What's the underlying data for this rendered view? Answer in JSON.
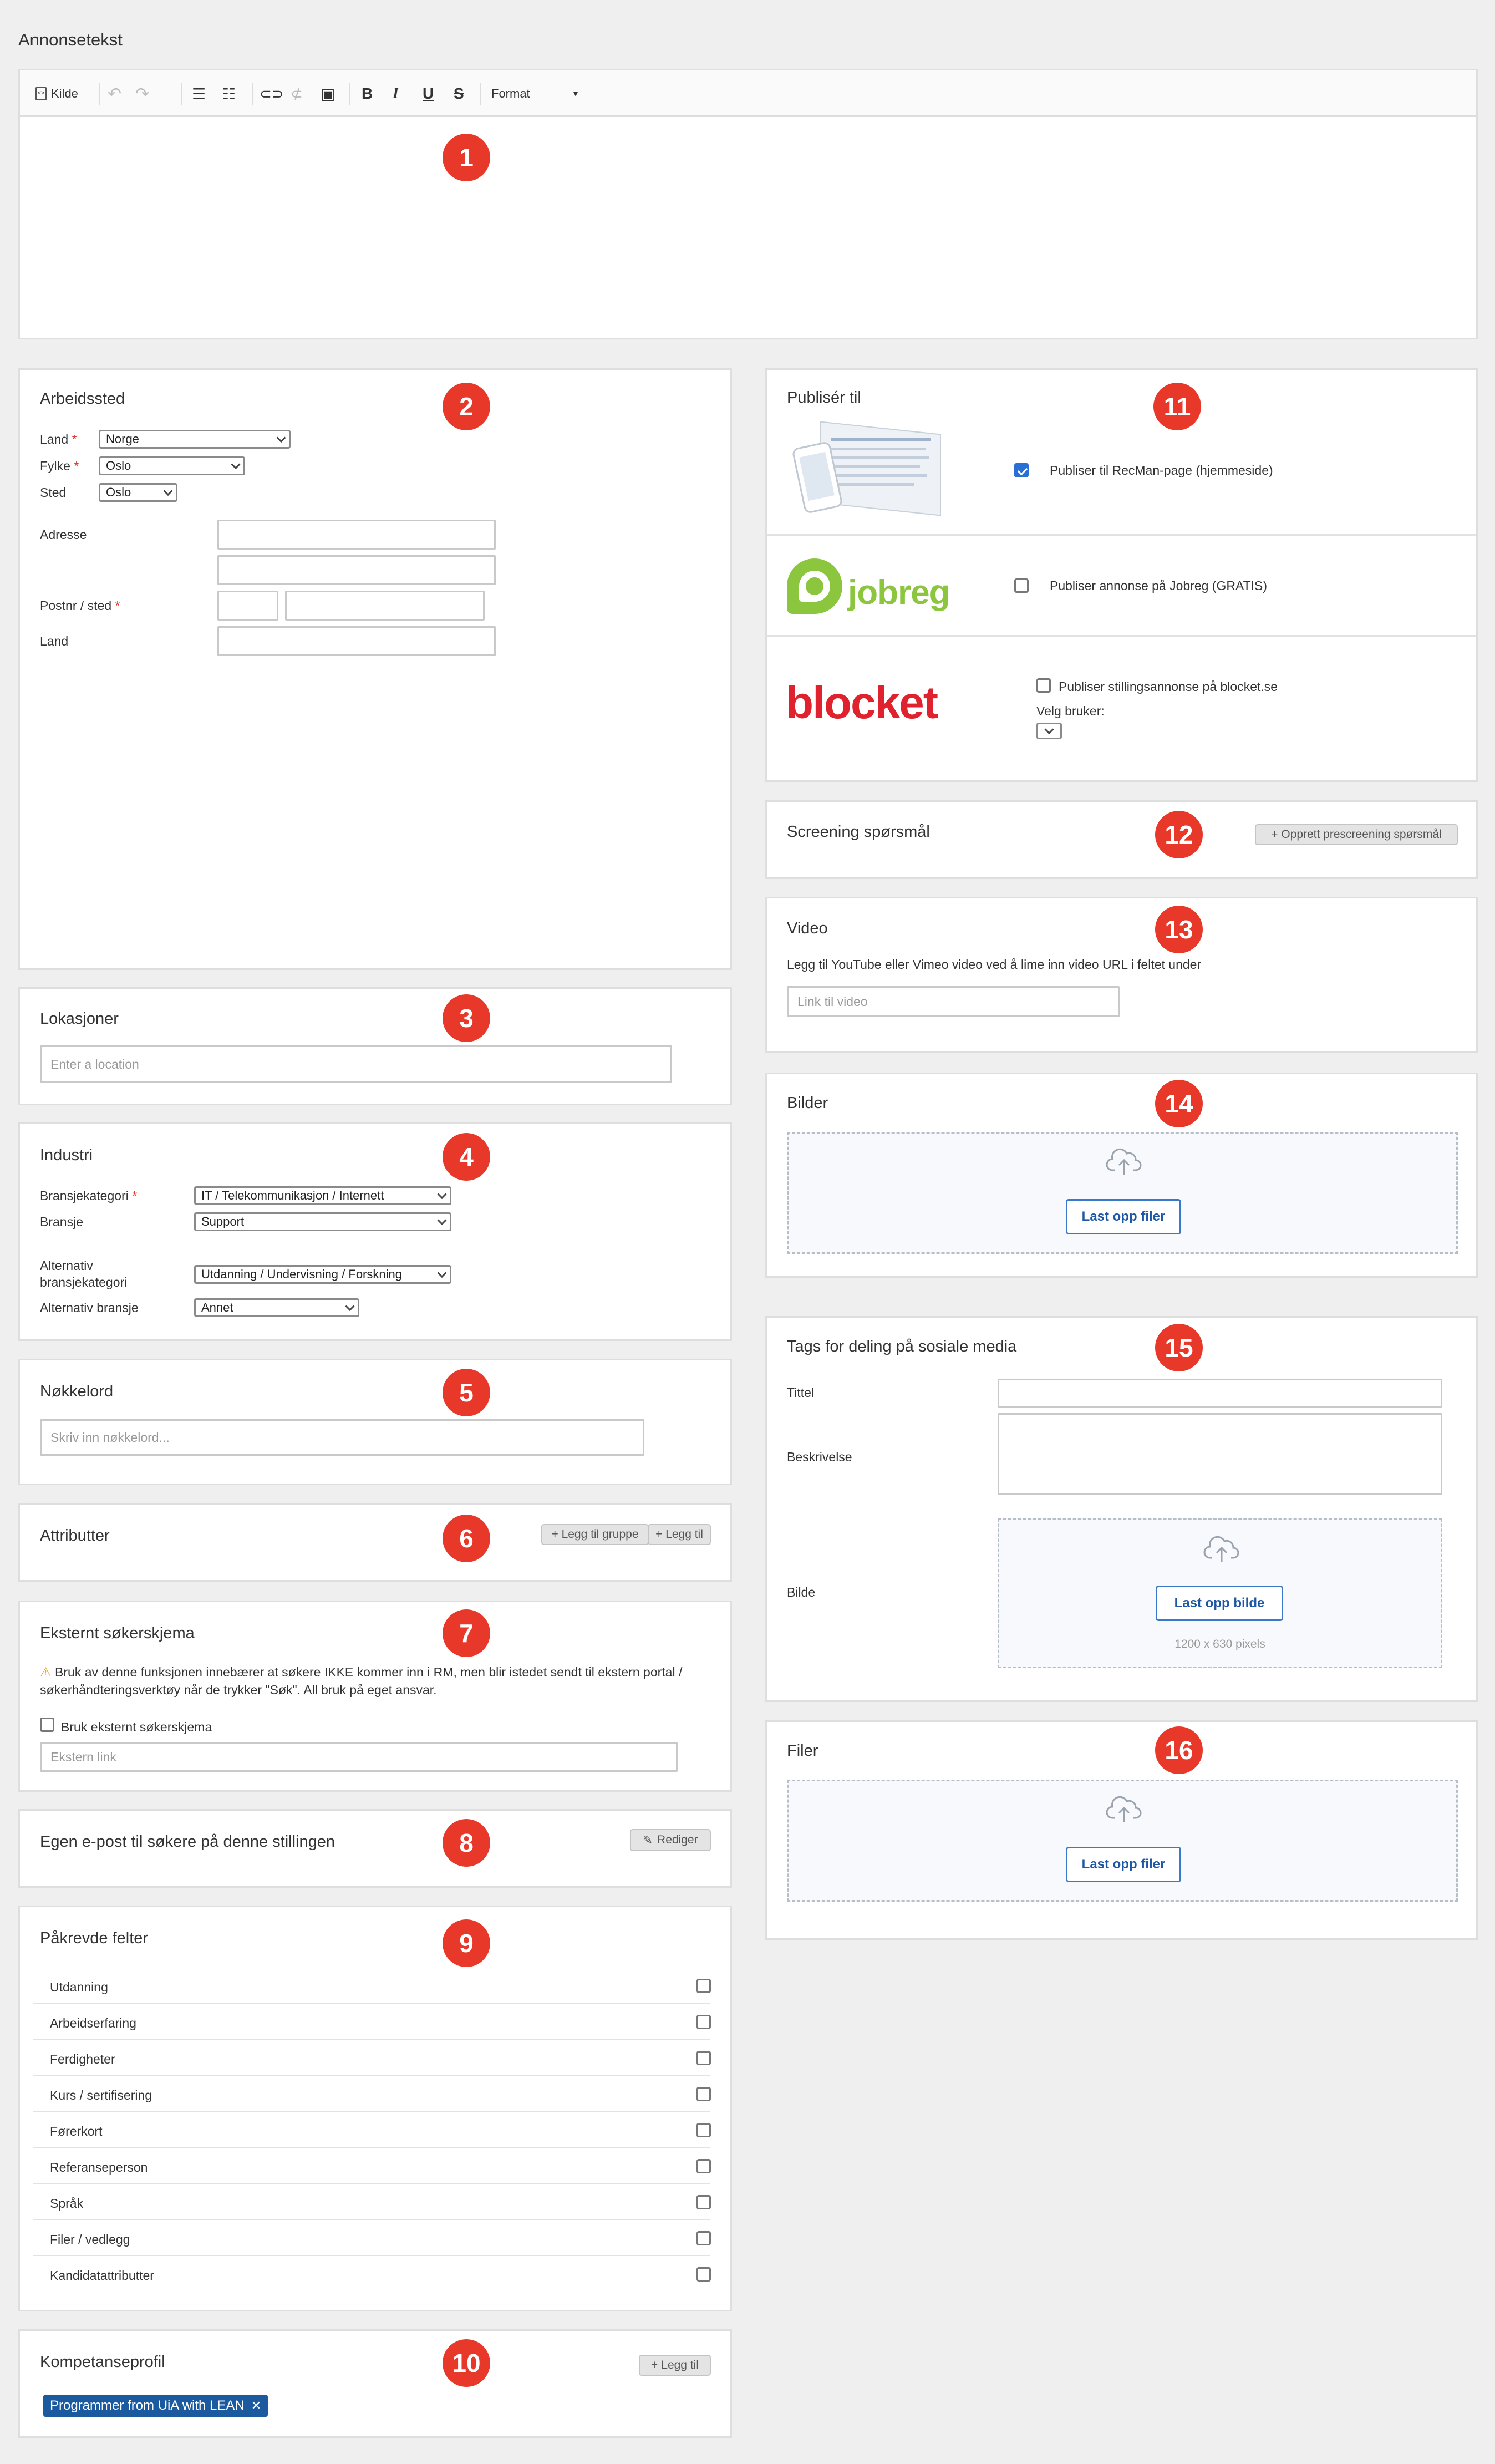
{
  "annonsetekst": {
    "title": "Annonsetekst",
    "toolbar": {
      "source_label": "Kilde",
      "format_label": "Format"
    }
  },
  "badges": [
    "1",
    "2",
    "3",
    "4",
    "5",
    "6",
    "7",
    "8",
    "9",
    "10",
    "11",
    "12",
    "13",
    "14",
    "15",
    "16"
  ],
  "arbeidssted": {
    "title": "Arbeidssted",
    "land_label": "Land",
    "land_value": "Norge",
    "fylke_label": "Fylke",
    "fylke_value": "Oslo",
    "sted_label": "Sted",
    "sted_value": "Oslo",
    "adresse_label": "Adresse",
    "postnr_label": "Postnr / sted",
    "land2_label": "Land",
    "required_marker": "*"
  },
  "lokasjoner": {
    "title": "Lokasjoner",
    "placeholder": "Enter a location"
  },
  "industri": {
    "title": "Industri",
    "bransjekategori_label": "Bransjekategori",
    "bransjekategori_value": "IT / Telekommunikasjon / Internett",
    "bransje_label": "Bransje",
    "bransje_value": "Support",
    "alt_kategori_label_1": "Alternativ",
    "alt_kategori_label_2": "bransjekategori",
    "alt_kategori_value": "Utdanning / Undervisning / Forskning",
    "alt_bransje_label": "Alternativ bransje",
    "alt_bransje_value": "Annet"
  },
  "nokkelord": {
    "title": "Nøkkelord",
    "placeholder": "Skriv inn nøkkelord..."
  },
  "attributter": {
    "title": "Attributter",
    "add_group_label": "+ Legg til gruppe",
    "add_label": "+ Legg til"
  },
  "eksternt": {
    "title": "Eksternt søkerskjema",
    "warning": "Bruk av denne funksjonen innebærer at søkere IKKE kommer inn i RM, men blir istedet sendt til ekstern portal / søkerhåndteringsverktøy når de trykker \"Søk\". All bruk på eget ansvar.",
    "checkbox_label": "Bruk eksternt søkerskjema",
    "placeholder": "Ekstern link"
  },
  "egen_epost": {
    "title": "Egen e-post til søkere på denne stillingen",
    "edit_label": "Rediger"
  },
  "pakrevde": {
    "title": "Påkrevde felter",
    "items": [
      "Utdanning",
      "Arbeidserfaring",
      "Ferdigheter",
      "Kurs / sertifisering",
      "Førerkort",
      "Referanseperson",
      "Språk",
      "Filer / vedlegg",
      "Kandidatattributter"
    ]
  },
  "kompetanse": {
    "title": "Kompetanseprofil",
    "add_label": "Legg til",
    "tag": "Programmer from UiA with LEAN",
    "tag_remove": "✕"
  },
  "publiser": {
    "title": "Publisér til",
    "recman_label": "Publiser til RecMan-page (hjemmeside)",
    "recman_checked": true,
    "jobreg_logo": "jobreg",
    "jobreg_label": "Publiser annonse på Jobreg (GRATIS)",
    "blocket_logo": "blocket",
    "blocket_label": "Publiser stillingsannonse på blocket.se",
    "velg_bruker": "Velg bruker:"
  },
  "screening": {
    "title": "Screening spørsmål",
    "button": "+ Opprett prescreening spørsmål"
  },
  "video": {
    "title": "Video",
    "hint": "Legg til YouTube eller Vimeo video ved å lime inn video URL i feltet under",
    "placeholder": "Link til video"
  },
  "bilder": {
    "title": "Bilder",
    "upload_label": "Last opp filer"
  },
  "tags": {
    "title": "Tags for deling på sosiale media",
    "tittel_label": "Tittel",
    "beskrivelse_label": "Beskrivelse",
    "bilde_label": "Bilde",
    "upload_label": "Last opp bilde",
    "size_hint": "1200 x 630 pixels"
  },
  "filer": {
    "title": "Filer",
    "upload_label": "Last opp filer"
  },
  "colors": {
    "badge": "#e8382a",
    "accent": "#1e57a6",
    "tag": "#1c5aa0",
    "jobreg": "#8cc63f",
    "blocket": "#e0212e"
  }
}
